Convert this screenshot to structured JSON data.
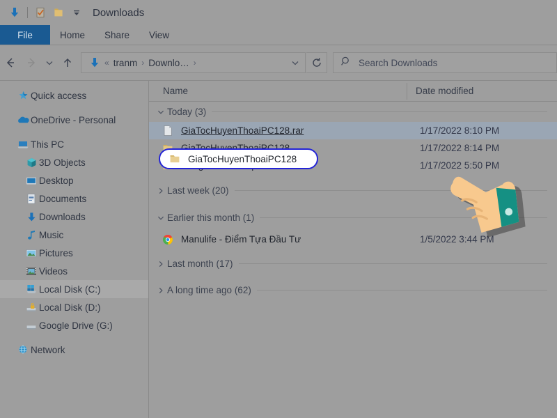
{
  "window": {
    "title": "Downloads",
    "quick_access_toolbar": [
      {
        "name": "download-icon",
        "label": "Downloads"
      },
      {
        "name": "properties-icon",
        "label": "Properties"
      },
      {
        "name": "new-folder-icon",
        "label": "New folder"
      },
      {
        "name": "customize-qat-chevron-icon",
        "label": "Customize Quick Access Toolbar"
      }
    ]
  },
  "ribbon": {
    "tabs": [
      {
        "label": "File",
        "active": true
      },
      {
        "label": "Home",
        "active": false
      },
      {
        "label": "Share",
        "active": false
      },
      {
        "label": "View",
        "active": false
      }
    ]
  },
  "navigation": {
    "back_label": "Back",
    "forward_label": "Forward",
    "recent_label": "Recent locations",
    "up_label": "Up",
    "refresh_label": "Refresh",
    "address_icon": "downloads-arrow-icon",
    "breadcrumbs": [
      {
        "label": "«",
        "type": "overflow"
      },
      {
        "label": "tranm",
        "type": "crumb"
      },
      {
        "label": "Downlo…",
        "type": "crumb"
      }
    ],
    "address_dropdown_label": "Previous locations"
  },
  "search": {
    "placeholder": "Search Downloads",
    "icon": "search-icon"
  },
  "sidebar": {
    "items": [
      {
        "label": "Quick access",
        "icon": "star-pin-icon",
        "indent": 0,
        "selected": false,
        "gap_after": true
      },
      {
        "label": "OneDrive - Personal",
        "icon": "onedrive-cloud-icon",
        "indent": 0,
        "selected": false,
        "gap_after": true
      },
      {
        "label": "This PC",
        "icon": "this-pc-icon",
        "indent": 0,
        "selected": false,
        "gap_after": false
      },
      {
        "label": "3D Objects",
        "icon": "3d-objects-icon",
        "indent": 1,
        "selected": false,
        "gap_after": false
      },
      {
        "label": "Desktop",
        "icon": "desktop-icon",
        "indent": 1,
        "selected": false,
        "gap_after": false
      },
      {
        "label": "Documents",
        "icon": "documents-icon",
        "indent": 1,
        "selected": false,
        "gap_after": false
      },
      {
        "label": "Downloads",
        "icon": "downloads-icon",
        "indent": 1,
        "selected": false,
        "gap_after": false
      },
      {
        "label": "Music",
        "icon": "music-icon",
        "indent": 1,
        "selected": false,
        "gap_after": false
      },
      {
        "label": "Pictures",
        "icon": "pictures-icon",
        "indent": 1,
        "selected": false,
        "gap_after": false
      },
      {
        "label": "Videos",
        "icon": "videos-icon",
        "indent": 1,
        "selected": false,
        "gap_after": false
      },
      {
        "label": "Local Disk (C:)",
        "icon": "windows-drive-icon",
        "indent": 1,
        "selected": true,
        "gap_after": false
      },
      {
        "label": "Local Disk (D:)",
        "icon": "locked-drive-icon",
        "indent": 1,
        "selected": false,
        "gap_after": false
      },
      {
        "label": "Google Drive (G:)",
        "icon": "drive-icon",
        "indent": 1,
        "selected": false,
        "gap_after": true
      },
      {
        "label": "Network",
        "icon": "network-icon",
        "indent": 0,
        "selected": false,
        "gap_after": false
      }
    ]
  },
  "filelist": {
    "columns": [
      {
        "label": "Name",
        "sorted": false
      },
      {
        "label": "Date modified",
        "sorted": true,
        "direction": "descending"
      }
    ],
    "groups": [
      {
        "label": "Today (3)",
        "expanded": true,
        "rows": [
          {
            "name": "GiaTocHuyenThoaiPC128.rar",
            "date": "1/17/2022 8:10 PM",
            "icon": "rar-file-icon",
            "selected": true
          },
          {
            "name": "GiaTocHuyenThoaiPC128",
            "date": "1/17/2022 8:14 PM",
            "icon": "folder-icon",
            "selected": false,
            "highlighted": true
          },
          {
            "name": "Telegram Desktop",
            "date": "1/17/2022 5:50 PM",
            "icon": "folder-icon",
            "selected": false
          }
        ]
      },
      {
        "label": "Last week (20)",
        "expanded": false,
        "rows": []
      },
      {
        "label": "Earlier this month (1)",
        "expanded": true,
        "rows": [
          {
            "name": "Manulife - Điểm Tựa Đầu Tư",
            "date": "1/5/2022 3:44 PM",
            "icon": "chrome-shortcut-icon",
            "selected": false
          }
        ]
      },
      {
        "label": "Last month (17)",
        "expanded": false,
        "rows": []
      },
      {
        "label": "A long time ago (62)",
        "expanded": false,
        "rows": []
      }
    ]
  },
  "annotation": {
    "highlight": {
      "target_label": "GiaTocHuyenThoaiPC128",
      "icon": "folder-icon",
      "border_color": "#2424d6",
      "fill_color": "#ffffff"
    },
    "cursor": {
      "name": "pointing-hand-cursor",
      "skin_color": "#f8c98e",
      "sleeve_color": "#159083"
    }
  },
  "colors": {
    "window_wash": "#9e9e9e",
    "file_tab": "#1a5a92",
    "selection": "#9aa6b4",
    "accent_blue": "#1e6fb8"
  }
}
